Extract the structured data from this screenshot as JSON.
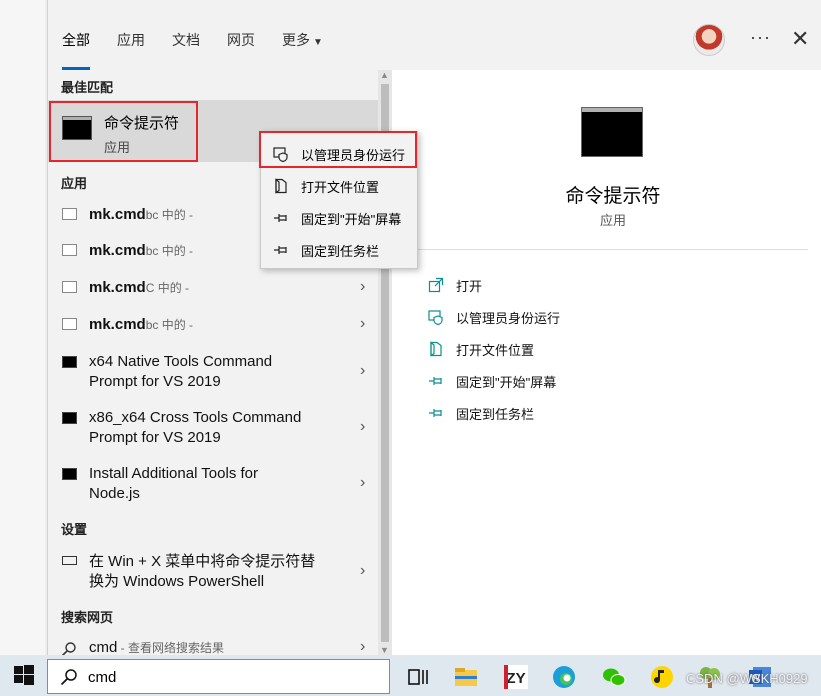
{
  "tabs": [
    {
      "label": "全部"
    },
    {
      "label": "应用"
    },
    {
      "label": "文档"
    },
    {
      "label": "网页"
    },
    {
      "label": "更多"
    }
  ],
  "best_match": {
    "heading": "最佳匹配",
    "title": "命令提示符",
    "subtitle": "应用"
  },
  "apps": {
    "heading": "应用",
    "items": [
      {
        "name": "mk.cmd",
        "sub": "bc 中的 -"
      },
      {
        "name": "mk.cmd",
        "sub": "bc 中的 -"
      },
      {
        "name": "mk.cmd",
        "sub": "C 中的 -"
      },
      {
        "name": "mk.cmd",
        "sub": "bc 中的 -"
      },
      {
        "line1": "x64 Native Tools Command",
        "line2": "Prompt for VS 2019"
      },
      {
        "line1": "x86_x64 Cross Tools Command",
        "line2": "Prompt for VS 2019"
      },
      {
        "line1": "Install Additional Tools for",
        "line2": "Node.js"
      }
    ]
  },
  "settings": {
    "heading": "设置",
    "line1": "在 Win + X 菜单中将命令提示符替",
    "line2": "换为 Windows PowerShell"
  },
  "web": {
    "heading": "搜索网页",
    "query": "cmd",
    "sub": " - 查看网络搜索结果"
  },
  "context_menu": [
    {
      "label": "以管理员身份运行",
      "icon": "shield-icon"
    },
    {
      "label": "打开文件位置",
      "icon": "folder-icon"
    },
    {
      "label": "固定到\"开始\"屏幕",
      "icon": "pin-icon"
    },
    {
      "label": "固定到任务栏",
      "icon": "pin-icon"
    }
  ],
  "detail": {
    "title": "命令提示符",
    "subtitle": "应用",
    "actions": [
      {
        "label": "打开",
        "icon": "open-icon"
      },
      {
        "label": "以管理员身份运行",
        "icon": "shield-icon"
      },
      {
        "label": "打开文件位置",
        "icon": "folder-icon"
      },
      {
        "label": "固定到\"开始\"屏幕",
        "icon": "pin-icon"
      },
      {
        "label": "固定到任务栏",
        "icon": "pin-icon"
      }
    ]
  },
  "search_box": {
    "value": "cmd"
  },
  "watermark": "CSDN @WSKH0929",
  "colors": {
    "accent": "#0067c0",
    "highlight": "#e5262b",
    "action_icon": "#0a8f8f"
  }
}
